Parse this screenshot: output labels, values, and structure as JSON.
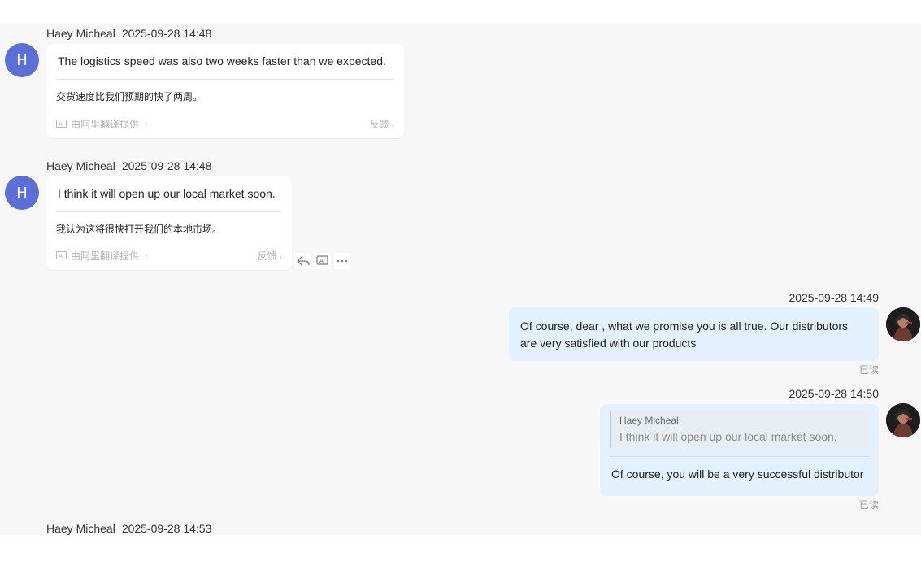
{
  "messages": [
    {
      "sender": "Haey Micheal",
      "avatar_letter": "H",
      "timestamp": "2025-09-28 14:48",
      "text": "The logistics speed was also two weeks faster than we expected.",
      "translation": "交货速度比我们预期的快了两周。",
      "provider": "由阿里翻译提供",
      "feedback": "反馈"
    },
    {
      "sender": "Haey Micheal",
      "avatar_letter": "H",
      "timestamp": "2025-09-28 14:48",
      "text": "I think it will open up our local market soon.",
      "translation": "我认为这将很快打开我们的本地市场。",
      "provider": "由阿里翻译提供",
      "feedback": "反馈"
    },
    {
      "timestamp": "2025-09-28 14:49",
      "line1": "Of course, dear , what we promise you is all true. Our distributors",
      "line2": "are very satisfied with our products",
      "status": "已读"
    },
    {
      "timestamp": "2025-09-28 14:50",
      "quote_name": "Haey Micheal:",
      "quote_text": "I think it will open up our local market soon.",
      "text": "Of course, you will be a very successful distributor",
      "status": "已读"
    },
    {
      "sender": "Haey Micheal",
      "timestamp": "2025-09-28 14:53"
    }
  ],
  "actions": {
    "reply": "reply-icon",
    "translate": "translate-icon",
    "more": "more-icon"
  },
  "colors": {
    "avatar_bg": "#5b6fd6",
    "outgoing_bubble": "#e3f0fd",
    "incoming_bubble": "#ffffff",
    "chat_bg": "#f7f7f8"
  }
}
